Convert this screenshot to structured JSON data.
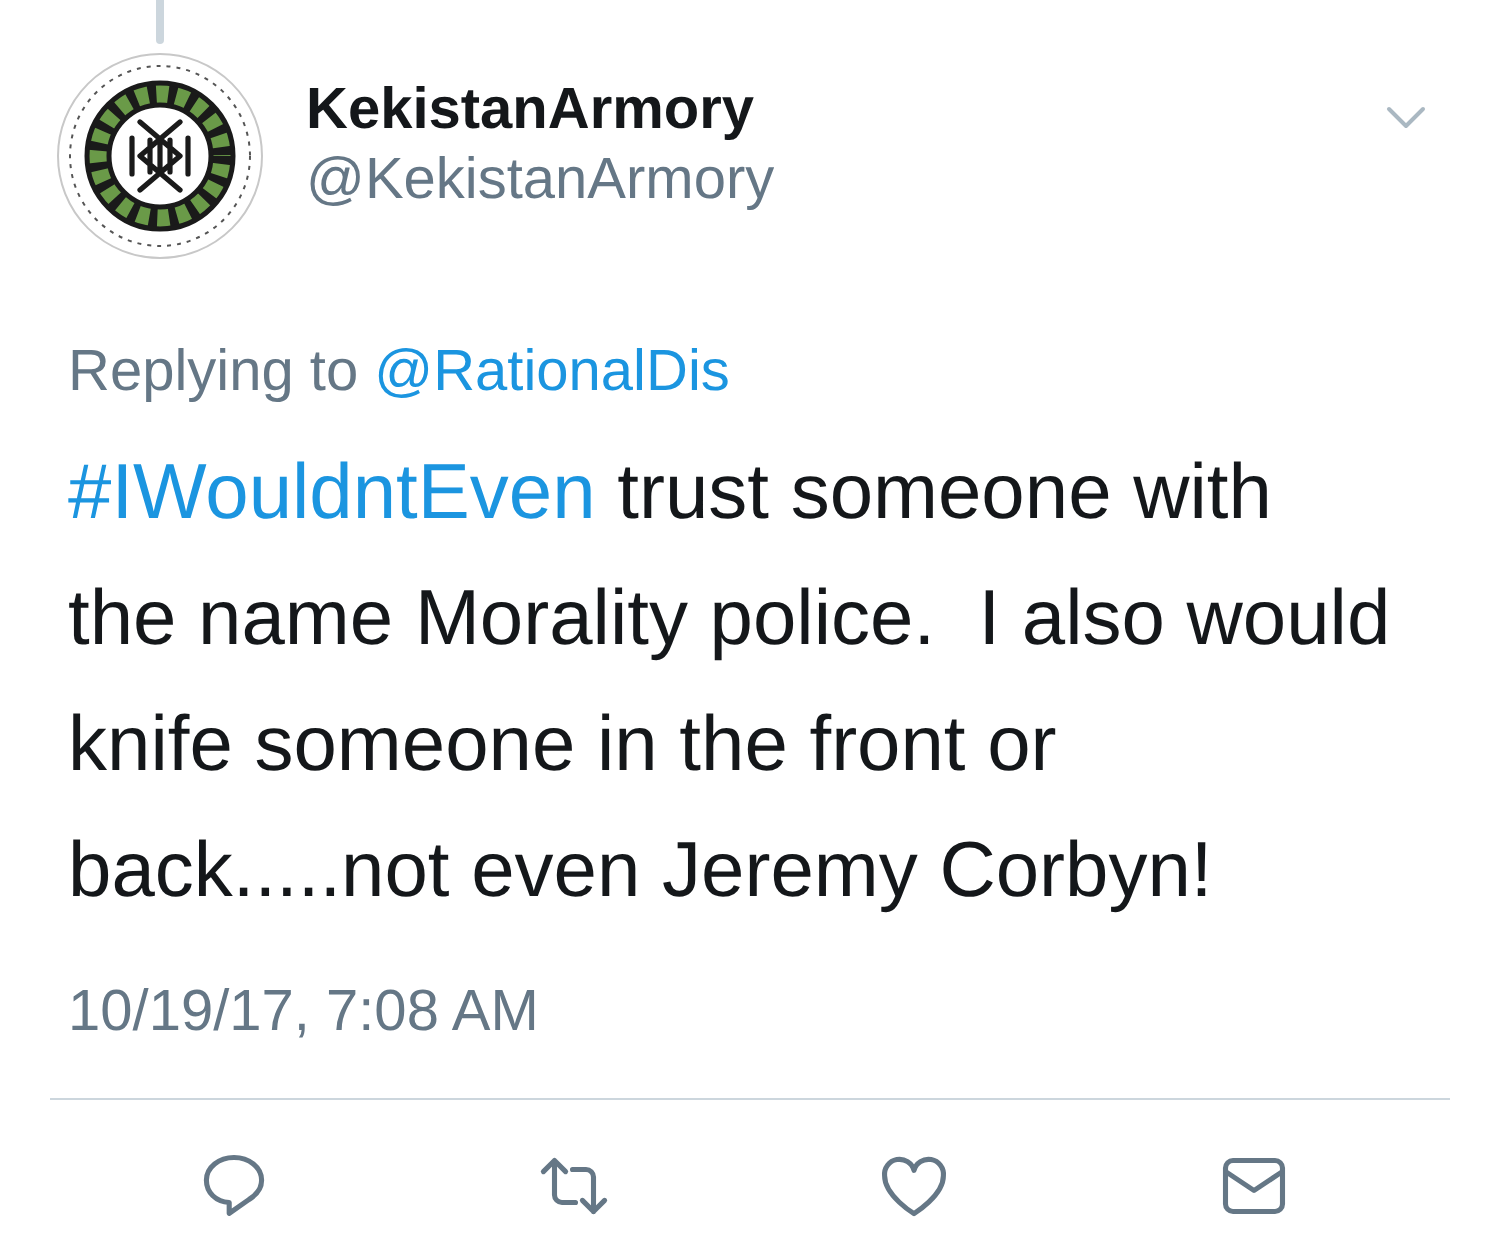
{
  "tweet": {
    "author": {
      "name": "KekistanArmory",
      "handle": "@KekistanArmory"
    },
    "reply_to": {
      "label": "Replying to",
      "handle": "@RationalDis"
    },
    "text": [
      {
        "kind": "hashtag",
        "text": "#IWouldntEven"
      },
      {
        "kind": "plain",
        "text": " trust someone with the name Morality police.  I also would knife someone in the front or back.....not even Jeremy Corbyn!"
      }
    ],
    "timestamp": "10/19/17, 7:08 AM"
  }
}
